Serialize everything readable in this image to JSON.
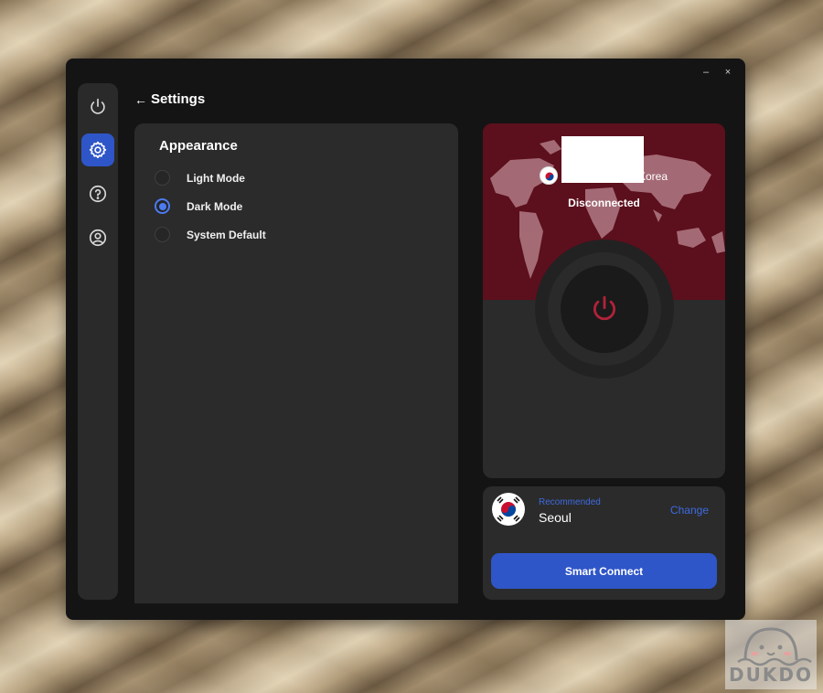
{
  "window": {
    "minimize_glyph": "–",
    "close_glyph": "×"
  },
  "sidebar": {
    "items": [
      {
        "icon": "power-icon",
        "active": false
      },
      {
        "icon": "gear-icon",
        "active": true
      },
      {
        "icon": "help-icon",
        "active": false
      },
      {
        "icon": "account-icon",
        "active": false
      }
    ]
  },
  "header": {
    "back_glyph": "←",
    "title": "Settings"
  },
  "settings": {
    "section_title": "Appearance",
    "options": [
      {
        "label": "Light Mode",
        "checked": false
      },
      {
        "label": "Dark Mode",
        "checked": true
      },
      {
        "label": "System Default",
        "checked": false
      }
    ]
  },
  "vpn": {
    "location_text": "Korea",
    "status": "Disconnected",
    "accent_color": "#5c0f1c",
    "power_icon_color": "#b0223a"
  },
  "server": {
    "recommended_label": "Recommended",
    "city": "Seoul",
    "change_label": "Change",
    "connect_button": "Smart Connect"
  },
  "watermark": {
    "text": "DUKDO"
  },
  "colors": {
    "accent_blue": "#2f56c8",
    "link_blue": "#3d6be0",
    "panel_bg": "#2b2b2b",
    "window_bg": "#141414"
  }
}
